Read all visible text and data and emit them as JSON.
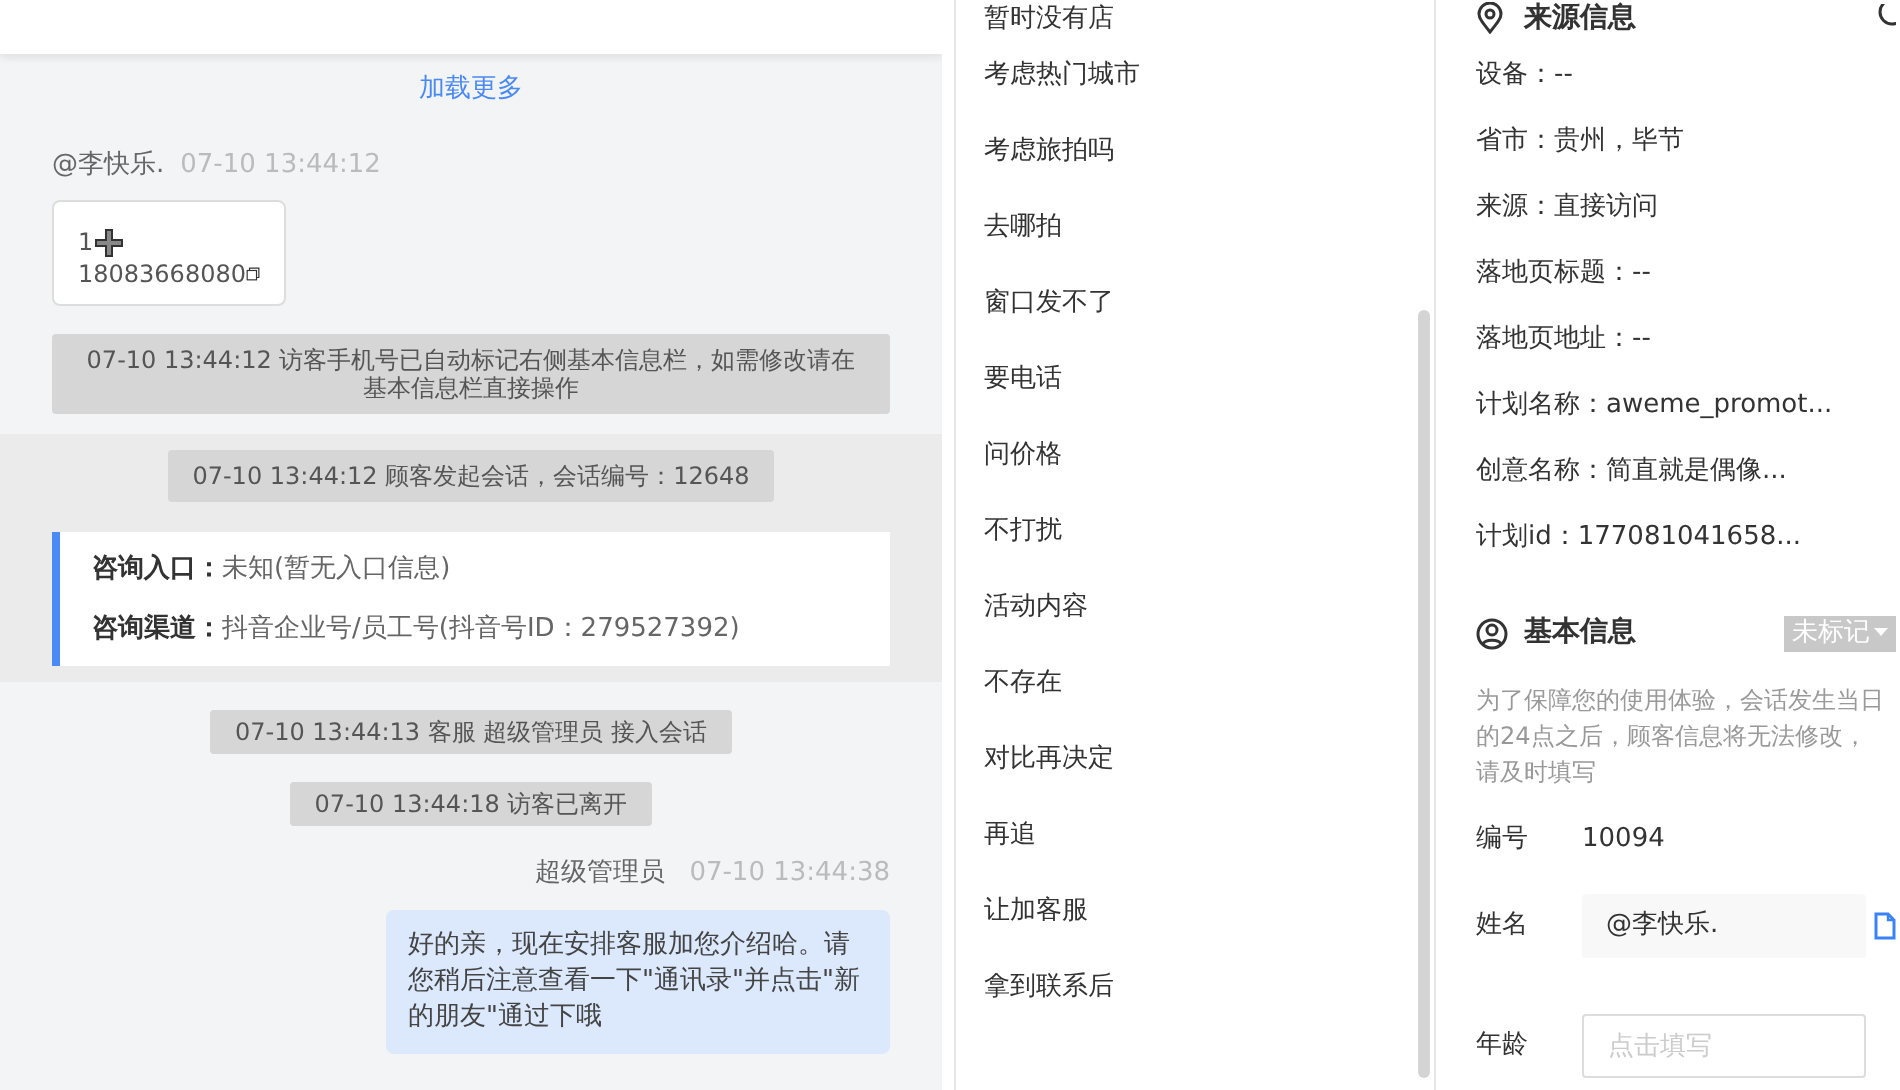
{
  "chat": {
    "load_more": "加载更多",
    "items": [
      {
        "kind": "visitor",
        "sender": "@李快乐.",
        "time": "07-10 13:44:12",
        "line_1": "1",
        "line_2": "18083668080"
      },
      {
        "kind": "system",
        "text": "07-10 13:44:12 访客手机号已自动标记右侧基本信息栏，如需修改请在基本信息栏直接操作"
      },
      {
        "kind": "session",
        "notice": "07-10 13:44:12 顾客发起会话，会话编号：12648",
        "fields": [
          {
            "label": "咨询入口：",
            "value": "未知(暂无入口信息)"
          },
          {
            "label": "咨询渠道：",
            "value": "抖音企业号/员工号(抖音号ID：279527392)"
          }
        ]
      },
      {
        "kind": "system",
        "text": "07-10 13:44:13 客服 超级管理员 接入会话"
      },
      {
        "kind": "system",
        "text": "07-10 13:44:18 访客已离开"
      },
      {
        "kind": "agent",
        "sender": "超级管理员",
        "time": "07-10 13:44:38",
        "text": "好的亲，现在安排客服加您介绍哈。请您稍后注意查看一下\"通讯录\"并点击\"新的朋友\"通过下哦"
      }
    ]
  },
  "quick_replies": [
    "暂时没有店",
    "考虑热门城市",
    "考虑旅拍吗",
    "去哪拍",
    "窗口发不了",
    "要电话",
    "问价格",
    "不打扰",
    "活动内容",
    "不存在",
    "对比再决定",
    "再追",
    "让加客服",
    "拿到联系后"
  ],
  "source_info": {
    "title": "来源信息",
    "rows": [
      "设备：--",
      "省市：贵州，毕节",
      "来源：直接访问",
      "落地页标题：--",
      "落地页地址：--",
      "计划名称：aweme_promot...",
      "创意名称：简直就是偶像...",
      "计划id：177081041658..."
    ]
  },
  "basic_info": {
    "title": "基本信息",
    "tag": "未标记",
    "notice": "为了保障您的使用体验，会话发生当日的24点之后，顾客信息将无法修改，请及时填写",
    "fields": [
      {
        "kind": "text",
        "label": "编号",
        "value": "10094"
      },
      {
        "kind": "readonly",
        "label": "姓名",
        "value": "@李快乐."
      },
      {
        "kind": "input",
        "label": "年龄",
        "placeholder": "点击填写"
      }
    ]
  }
}
